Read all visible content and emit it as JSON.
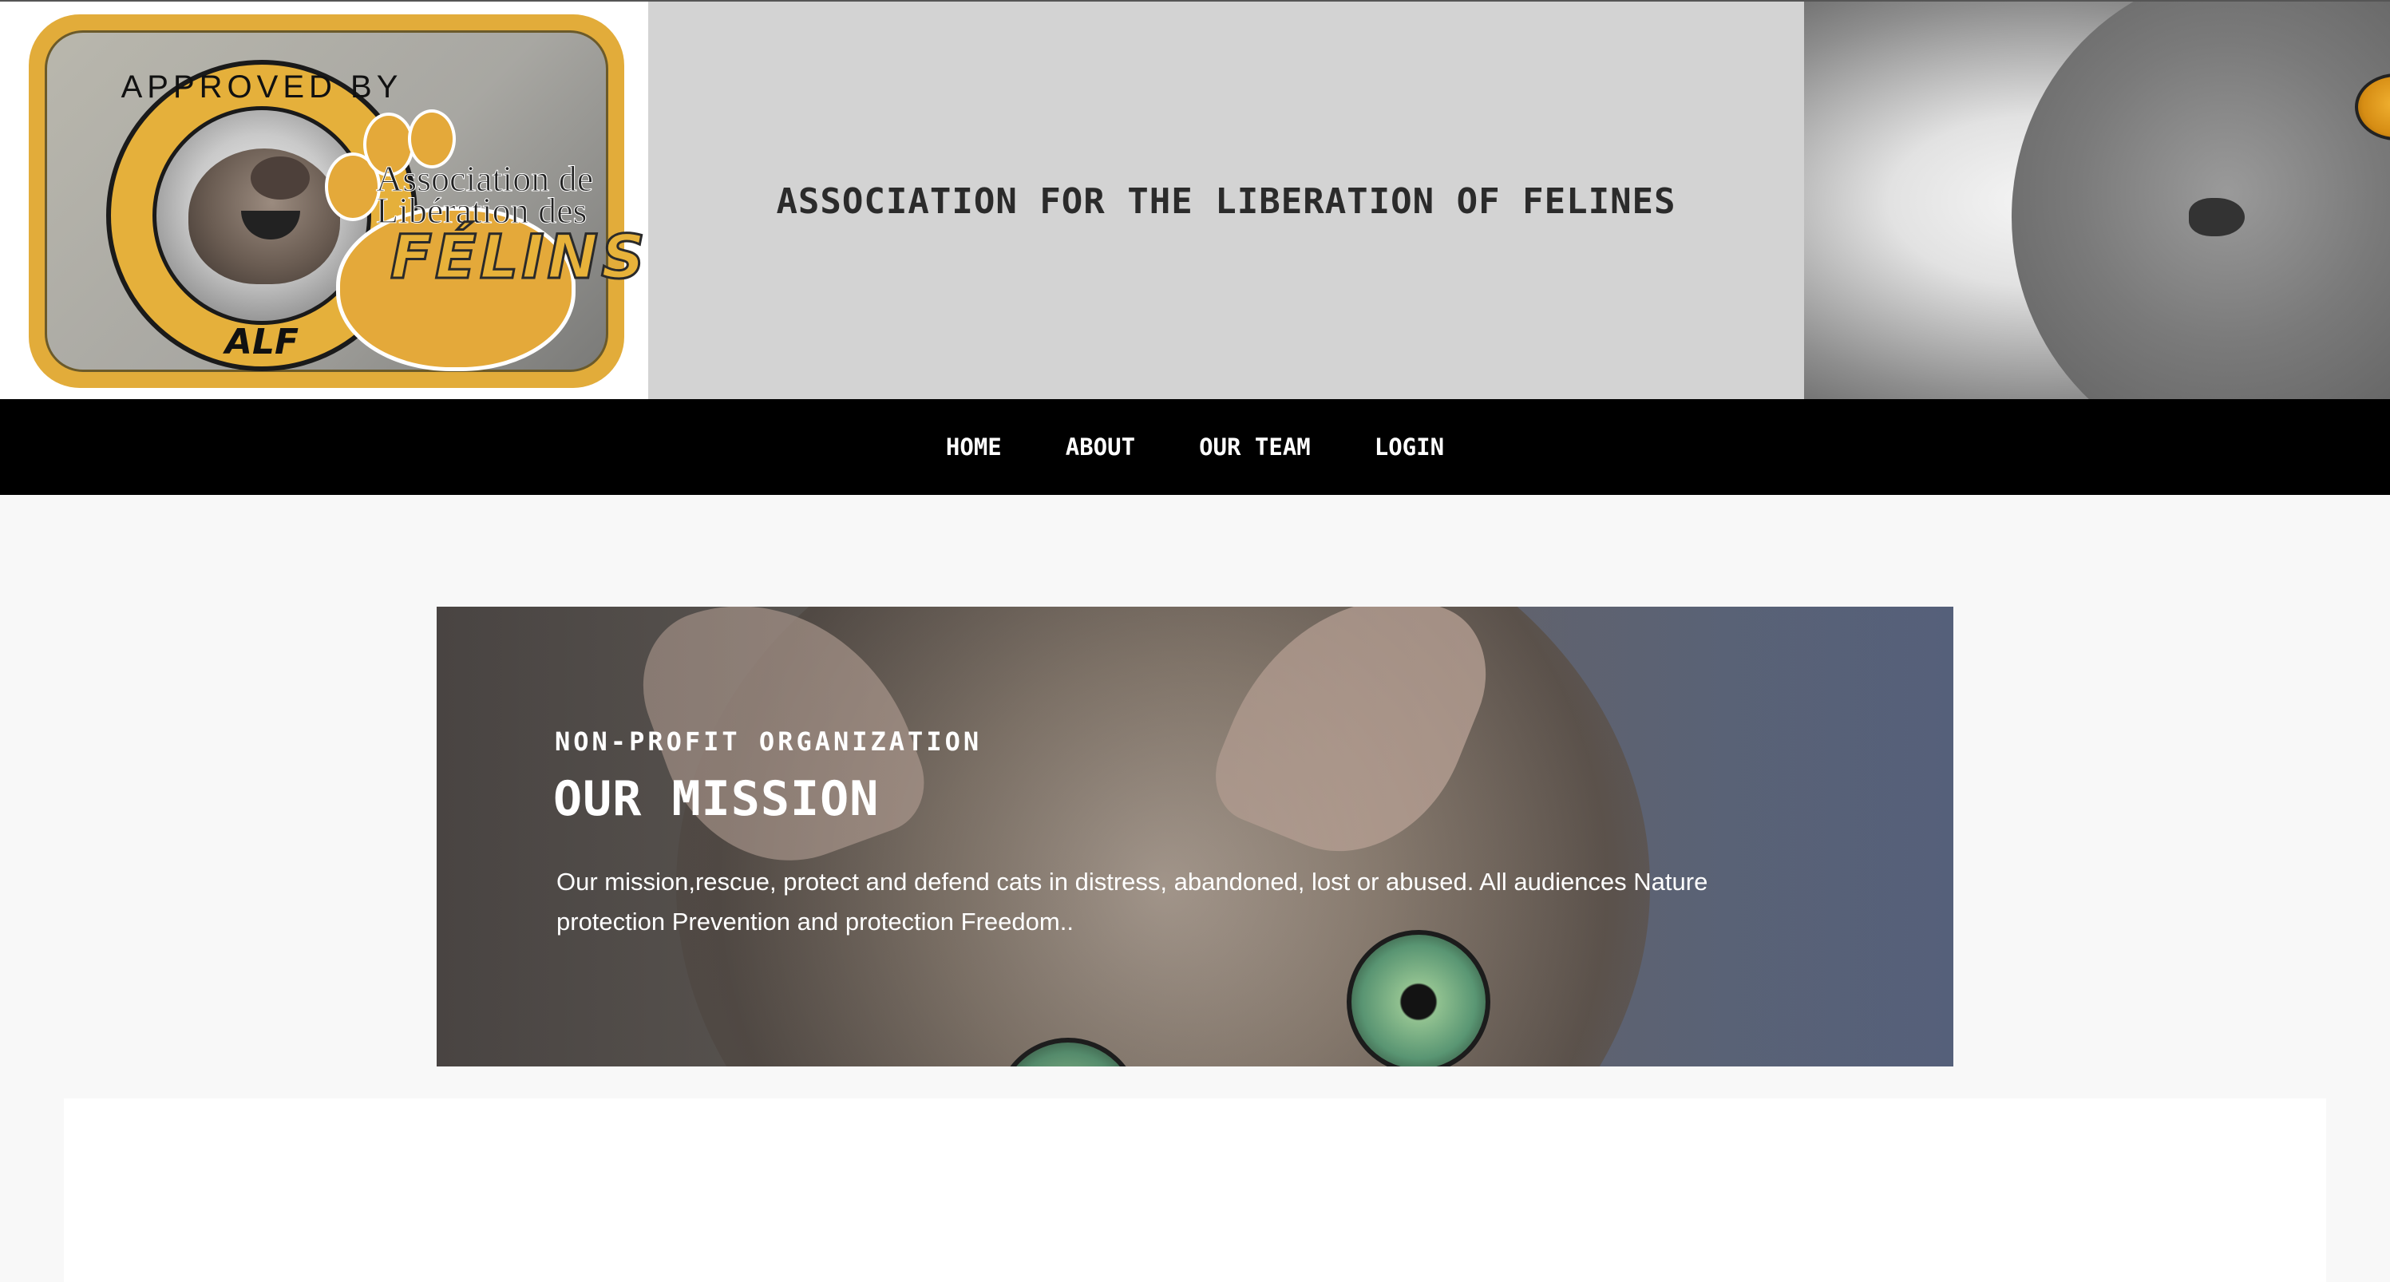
{
  "header": {
    "logo": {
      "seal_top": "APPROVED BY",
      "seal_bottom": "ALF",
      "line1": "Association de",
      "line2": "Libération des",
      "line3": "FÉLINS"
    },
    "site_title": "ASSOCIATION FOR THE LIBERATION OF FELINES"
  },
  "nav": {
    "items": [
      {
        "label": "HOME"
      },
      {
        "label": "ABOUT"
      },
      {
        "label": "OUR TEAM"
      },
      {
        "label": "LOGIN"
      }
    ]
  },
  "hero": {
    "kicker": "NON-PROFIT ORGANIZATION",
    "title": "OUR MISSION",
    "text": "Our mission,rescue, protect and defend cats in distress, abandoned, lost or abused. All audiences Nature protection Prevention and protection Freedom.."
  },
  "colors": {
    "nav_bg": "#000000",
    "header_bg": "#d3d3d3",
    "logo_gold": "#e2ac3a",
    "page_bg": "#f8f8f8"
  }
}
